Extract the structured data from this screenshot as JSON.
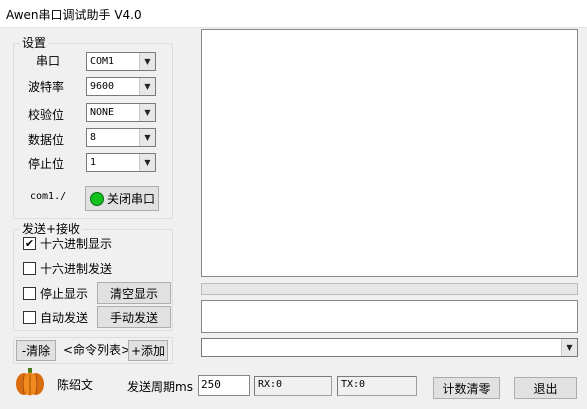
{
  "window": {
    "title": "Awen串口调试助手 V4.0"
  },
  "settings": {
    "legend": "设置",
    "rows": [
      {
        "label": "串口",
        "value": "COM1"
      },
      {
        "label": "波特率",
        "value": "9600"
      },
      {
        "label": "校验位",
        "value": "NONE"
      },
      {
        "label": "数据位",
        "value": "8"
      },
      {
        "label": "停止位",
        "value": "1"
      }
    ],
    "status_text": "com1./",
    "toggle_label": "关闭串口",
    "led_color": "#12c21e"
  },
  "send_recv": {
    "legend": "发送+接收",
    "hex_display": {
      "label": "十六进制显示",
      "checked": true,
      "mark": "✔"
    },
    "hex_send": {
      "label": "十六进制发送",
      "checked": false
    },
    "stop_display": {
      "label": "停止显示",
      "checked": false
    },
    "auto_send": {
      "label": "自动发送",
      "checked": false
    },
    "clear_display_label": "清空显示",
    "manual_send_label": "手动发送"
  },
  "cmd": {
    "delete_label": "-清除",
    "list_label": "<命令列表>",
    "add_label": "+添加"
  },
  "footer": {
    "author": "陈绍文",
    "period_label": "发送周期ms",
    "period_value": "250",
    "rx": "RX:0",
    "tx": "TX:0",
    "reset_label": "计数清零",
    "exit_label": "退出"
  },
  "icons": {
    "pumpkin": "pumpkin-icon",
    "dropdown": "chevron-down-icon"
  },
  "colors": {
    "accent_led": "#12c21e",
    "window_bg": "#f0f0f0"
  }
}
